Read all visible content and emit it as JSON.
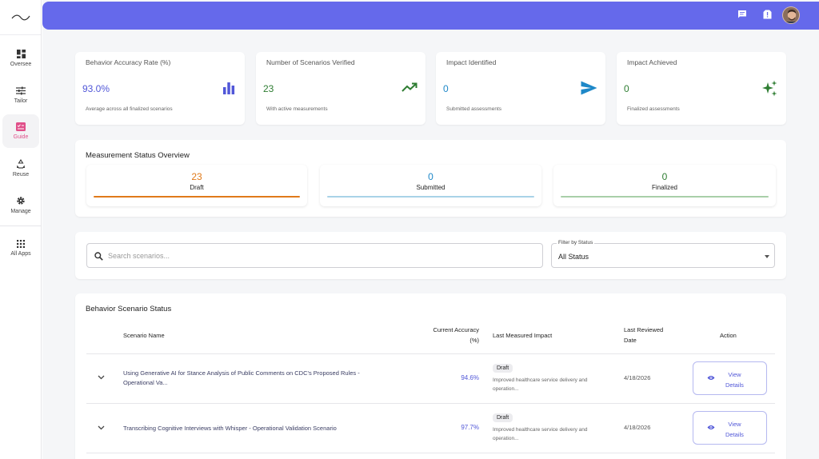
{
  "sidebar": {
    "items": [
      {
        "label": "Oversee",
        "icon": "dashboard-icon"
      },
      {
        "label": "Tailor",
        "icon": "sliders-icon"
      },
      {
        "label": "Guide",
        "icon": "checklist-icon"
      },
      {
        "label": "Reuse",
        "icon": "recycle-icon"
      },
      {
        "label": "Manage",
        "icon": "gear-icon"
      },
      {
        "label": "All Apps",
        "icon": "apps-grid-icon"
      }
    ]
  },
  "header": {
    "icons": [
      "chat-icon",
      "alert-icon",
      "user-avatar"
    ],
    "color": "#6569eb"
  },
  "stats": [
    {
      "title": "Behavior Accuracy Rate (%)",
      "value": "93.0%",
      "subtitle": "Average across all finalized scenarios",
      "icon": "bar-chart-icon",
      "color": "#5157d8"
    },
    {
      "title": "Number of Scenarios Verified",
      "value": "23",
      "subtitle": "With active measurements",
      "icon": "trending-up-icon",
      "color": "#2e7d32"
    },
    {
      "title": "Impact Identified",
      "value": "0",
      "subtitle": "Submitted assessments",
      "icon": "send-icon",
      "color": "#1e88c8"
    },
    {
      "title": "Impact Achieved",
      "value": "0",
      "subtitle": "Finalized assessments",
      "icon": "sparkle-icon",
      "color": "#2e7d32"
    }
  ],
  "measurement": {
    "title": "Measurement Status Overview",
    "items": [
      {
        "value": "23",
        "label": "Draft",
        "color": "#e07a1a"
      },
      {
        "value": "0",
        "label": "Submitted",
        "color": "#1e88c8"
      },
      {
        "value": "0",
        "label": "Finalized",
        "color": "#2e7d32"
      }
    ]
  },
  "search": {
    "placeholder": "Search scenarios...",
    "filter_label": "Filter by Status",
    "filter_value": "All Status"
  },
  "table": {
    "title": "Behavior Scenario Status",
    "headers": {
      "name": "Scenario Name",
      "accuracy_1": "Current Accuracy",
      "accuracy_2": "(%)",
      "impact": "Last Measured Impact",
      "date_1": "Last Reviewed",
      "date_2": "Date",
      "action": "Action"
    },
    "rows": [
      {
        "name_1": "Using Generative AI for Stance Analysis of Public Comments on CDC's Proposed Rules -",
        "name_2": "Operational Va...",
        "accuracy": "94.6%",
        "status": "Draft",
        "impact_1": "Improved healthcare service delivery and",
        "impact_2": "operation...",
        "date": "4/18/2026",
        "button_1": "View",
        "button_2": "Details"
      },
      {
        "name_1": "Transcribing Cognitive Interviews with Whisper - Operational Validation Scenario",
        "name_2": "",
        "accuracy": "97.7%",
        "status": "Draft",
        "impact_1": "Improved healthcare service delivery and",
        "impact_2": "operation...",
        "date": "4/18/2026",
        "button_1": "View",
        "button_2": "Details"
      }
    ]
  }
}
